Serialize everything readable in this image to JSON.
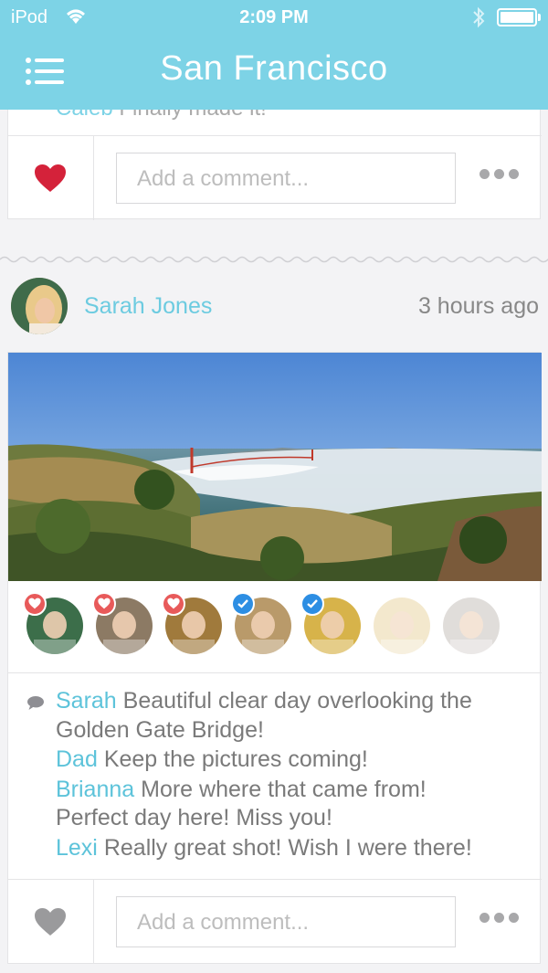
{
  "status_bar": {
    "carrier": "iPod",
    "time": "2:09 PM"
  },
  "header": {
    "title": "San Francisco"
  },
  "previous_post": {
    "peek_name": "Caleb",
    "peek_text": "Finally made it!",
    "liked": true,
    "comment_placeholder": "Add a comment..."
  },
  "post": {
    "author": "Sarah Jones",
    "timestamp": "3 hours ago",
    "likers": [
      {
        "badge": "heart",
        "color": "#3c6e4a"
      },
      {
        "badge": "heart",
        "color": "#8c7a64"
      },
      {
        "badge": "heart",
        "color": "#a07a3c"
      },
      {
        "badge": "check",
        "color": "#b99a6a"
      },
      {
        "badge": "check",
        "color": "#d7b34a"
      },
      {
        "badge": "none",
        "color": "#ead7a6"
      },
      {
        "badge": "none",
        "color": "#c8c2bd"
      }
    ],
    "comments": [
      {
        "name": "Sarah",
        "text": "Beautiful clear day overlooking the"
      },
      {
        "name": "",
        "text": "Golden Gate Bridge!"
      },
      {
        "name": "Dad",
        "text": "Keep the pictures coming!"
      },
      {
        "name": "Brianna",
        "text": "More where that came from!"
      },
      {
        "name": "",
        "text": "Perfect day here! Miss you!"
      },
      {
        "name": "Lexi",
        "text": "Really great shot! Wish I were there!"
      }
    ],
    "liked": false,
    "comment_placeholder": "Add a comment..."
  },
  "colors": {
    "accent": "#7dd3e6",
    "name": "#5dc3da",
    "liked_heart": "#d4223a",
    "unliked_heart": "#9a9a9c"
  }
}
